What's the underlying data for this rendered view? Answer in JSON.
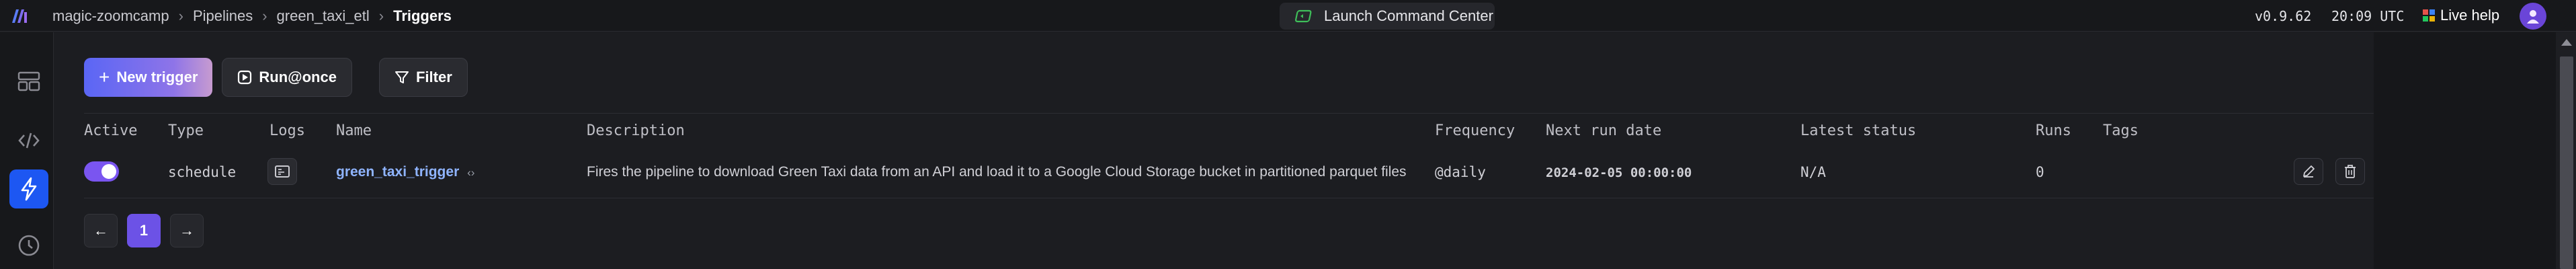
{
  "header": {
    "breadcrumb": [
      "magic-zoomcamp",
      "Pipelines",
      "green_taxi_etl",
      "Triggers"
    ],
    "command_center": "Launch Command Center",
    "version": "v0.9.62",
    "time": "20:09 UTC",
    "live_help": "Live help"
  },
  "sidebar": {
    "items": [
      {
        "icon": "layout-icon",
        "active": false
      },
      {
        "icon": "code-icon",
        "active": false
      },
      {
        "icon": "lightning-icon",
        "active": true
      },
      {
        "icon": "clock-icon",
        "active": false
      }
    ]
  },
  "toolbar": {
    "new_trigger": "New trigger",
    "run_once": "Run@once",
    "filter": "Filter"
  },
  "table": {
    "columns": [
      "Active",
      "Type",
      "Logs",
      "Name",
      "Description",
      "Frequency",
      "Next run date",
      "Latest status",
      "Runs",
      "Tags"
    ],
    "rows": [
      {
        "active": true,
        "type": "schedule",
        "name": "green_taxi_trigger",
        "description": "Fires the pipeline to download Green Taxi data from an API and load it to a Google Cloud Storage bucket in partitioned parquet files",
        "frequency": "@daily",
        "next_run_date": "2024-02-05 00:00:00",
        "latest_status": "N/A",
        "runs": "0",
        "tags": ""
      }
    ]
  },
  "pagination": {
    "prev": "←",
    "current_page": "1",
    "next": "→"
  },
  "colors": {
    "accent": "#6c52e6",
    "active_sidebar": "#1d57f2",
    "link": "#8fb4ff"
  }
}
